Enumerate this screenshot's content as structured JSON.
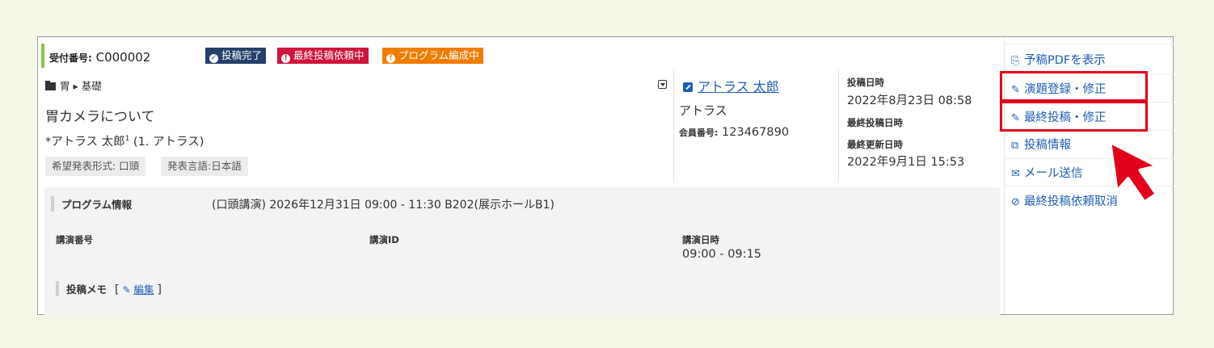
{
  "header": {
    "receipt_label": "受付番号:",
    "receipt_value": "C000002",
    "badges": [
      {
        "label": "投稿完了",
        "color": "#24406a",
        "icon": "check-circle-icon"
      },
      {
        "label": "最終投稿依頼中",
        "color": "#d0143c",
        "icon": "exclamation-circle-icon"
      },
      {
        "label": "プログラム編成中",
        "color": "#f07c00",
        "icon": "exclamation-circle-icon"
      }
    ]
  },
  "submission": {
    "breadcrumb": "胃 ▸ 基礎",
    "title": "胃カメラについて",
    "author": "*アトラス 太郎",
    "author_sup": "1",
    "author_affil": " (1. アトラス)",
    "tags": [
      "希望発表形式: 口頭",
      "発表言語:日本語"
    ]
  },
  "author_panel": {
    "name": "アトラス 太郎",
    "org": "アトラス",
    "member_label": "会員番号:",
    "member_value": "123467890"
  },
  "dates": {
    "posted_label": "投稿日時",
    "posted_value": "2022年8月23日 08:58",
    "final_label": "最終投稿日時",
    "updated_label": "最終更新日時",
    "updated_value": "2022年9月1日 15:53"
  },
  "program": {
    "heading": "プログラム情報",
    "detail": "(口頭講演) 2026年12月31日 09:00 - 11:30 B202(展示ホールB1)",
    "col_number": "講演番号",
    "col_id": "講演ID",
    "col_time": "講演日時",
    "time_value": "09:00 - 09:15",
    "memo_heading": "投稿メモ",
    "memo_open": "[",
    "memo_edit": "編集",
    "memo_close": "]"
  },
  "sidebar": {
    "items": [
      {
        "label": "予稿PDFを表示",
        "icon": "pdf-file-icon",
        "glyph": "⎘"
      },
      {
        "label": "演題登録・修正",
        "icon": "pencil-icon",
        "glyph": "✎"
      },
      {
        "label": "最終投稿・修正",
        "icon": "pencil-icon",
        "glyph": "✎"
      },
      {
        "label": "投稿情報",
        "icon": "copy-icon",
        "glyph": "⧉"
      },
      {
        "label": "メール送信",
        "icon": "envelope-icon",
        "glyph": "✉"
      },
      {
        "label": "最終投稿依頼取消",
        "icon": "ban-icon",
        "glyph": "⊘"
      }
    ],
    "highlight_color": "#e3001b"
  },
  "colors": {
    "accent_link": "#1f5db5",
    "bar": "#8bc34a",
    "background": "#f2f7e6"
  }
}
